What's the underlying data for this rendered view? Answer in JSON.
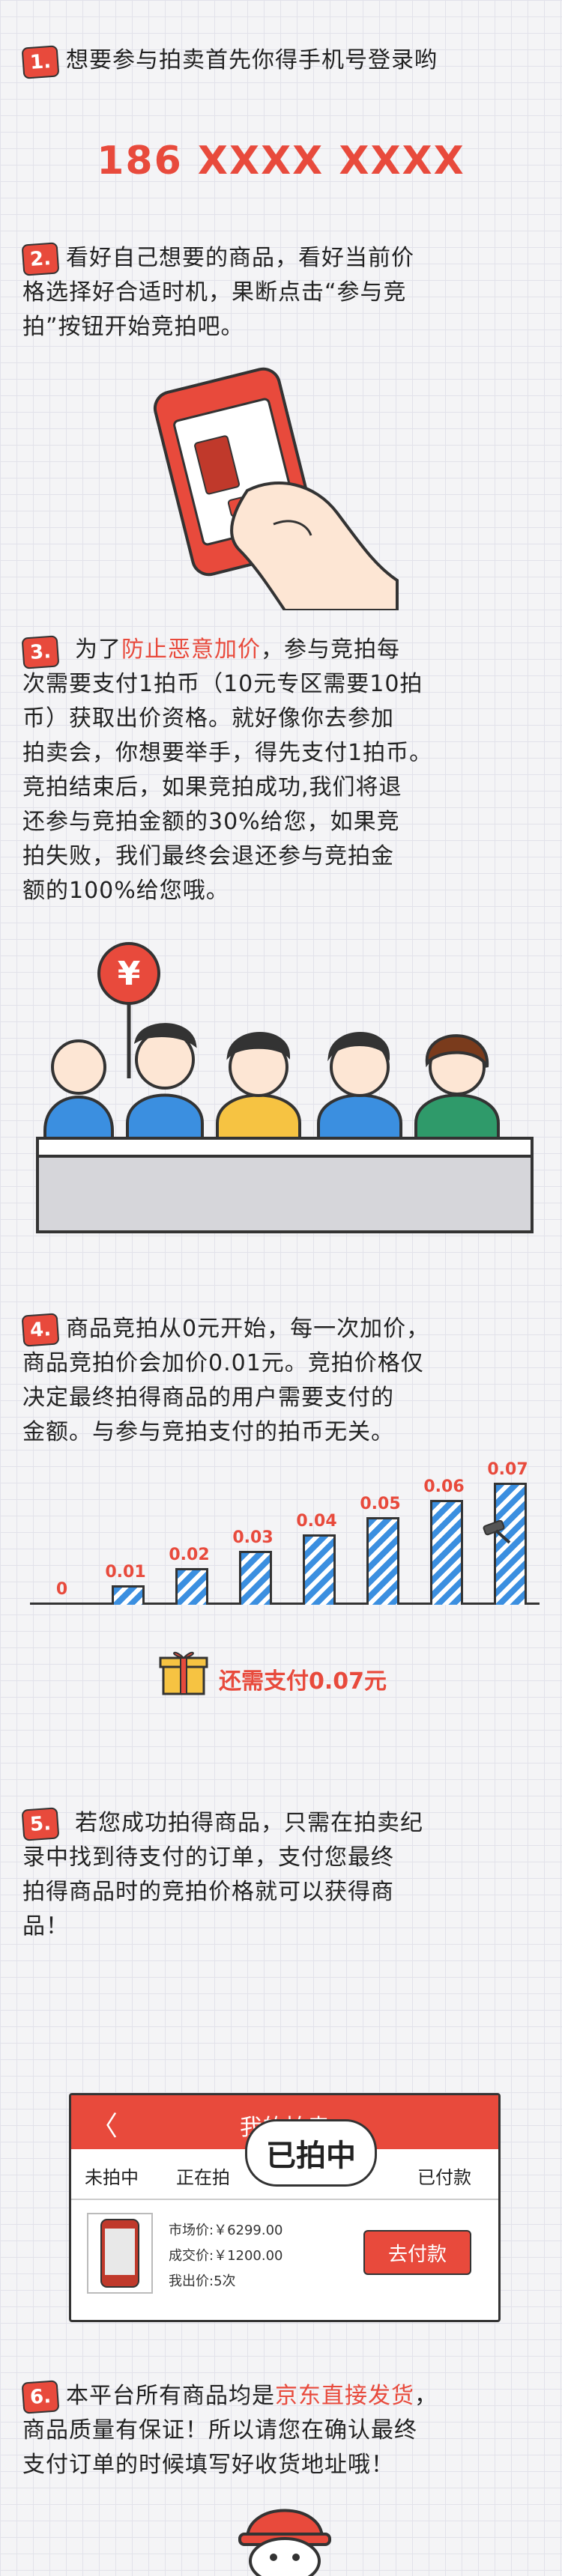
{
  "colors": {
    "accent": "#e84a3c",
    "bar": "#3b8fe0",
    "text": "#222222"
  },
  "step1": {
    "num": "1.",
    "text": "想要参与拍卖首先你得手机号登录哟",
    "phone": "186 XXXX XXXX"
  },
  "step2": {
    "num": "2.",
    "lines": [
      "看好自己想要的商品，看好当前价",
      "格选择好合适时机，果断点击“参与竞",
      "拍”按钮开始竞拍吧。"
    ]
  },
  "step3": {
    "num": "3.",
    "line1_pre": "为了",
    "line1_hl": "防止恶意加价",
    "line1_post": "，参与竞拍每",
    "lines": [
      "次需要支付1拍币（10元专区需要10拍",
      "币）获取出价资格。就好像你去参加",
      "拍卖会，你想要举手，得先支付1拍币。",
      "竞拍结束后，如果竞拍成功,我们将退",
      "还参与竞拍金额的30%给您，如果竞",
      "拍失败，我们最终会退还参与竞拍金",
      "额的100%给您哦。"
    ],
    "sign_icon": "yen-sign-icon"
  },
  "step4": {
    "num": "4.",
    "lines": [
      "商品竞拍从0元开始，每一次加价，",
      "商品竞拍价会加价0.01元。竞拍价格仅",
      "决定最终拍得商品的用户需要支付的",
      "金额。与参与竞拍支付的拍币无关。"
    ],
    "gift_text": "还需支付0.07元"
  },
  "chart_data": {
    "type": "bar",
    "categories": [
      "0",
      "0.01",
      "0.02",
      "0.03",
      "0.04",
      "0.05",
      "0.06",
      "0.07"
    ],
    "values": [
      0,
      0.01,
      0.02,
      0.03,
      0.04,
      0.05,
      0.06,
      0.07
    ],
    "title": "",
    "xlabel": "",
    "ylabel": "",
    "ylim": [
      0,
      0.07
    ]
  },
  "step5": {
    "num": "5.",
    "lines": [
      "若您成功拍得商品，只需在拍卖纪",
      "录中找到待支付的订单，支付您最终",
      "拍得商品时的竞拍价格就可以获得商",
      "品！"
    ],
    "card": {
      "back": "〈",
      "title": "我的拍卖",
      "tabs": [
        "未拍中",
        "正在拍",
        "已拍中",
        "已付款"
      ],
      "market_price": "市场价:￥6299.00",
      "deal_price": "成交价:￥1200.00",
      "bid_count": "我出价:5次",
      "pay_button": "去付款"
    }
  },
  "step6": {
    "num": "6.",
    "line1_pre": "本平台所有商品均是",
    "line1_hl": "京东直接发货",
    "line1_post": "，",
    "lines": [
      "商品质量有保证！所以请您在确认最终",
      "支付订单的时候填写好收货地址哦！"
    ]
  }
}
